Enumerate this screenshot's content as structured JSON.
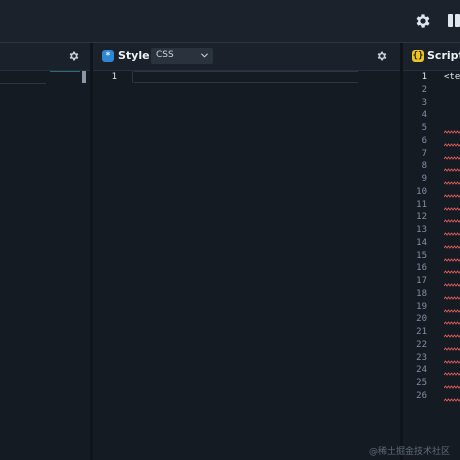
{
  "toolbar": {
    "settings_icon": "gear-icon",
    "layout_icon": "layout-columns-icon"
  },
  "panels": {
    "left": {
      "settings_icon": "gear-icon"
    },
    "style": {
      "badge_icon": "asterisk-icon",
      "badge_color": "#2f86d6",
      "title": "Style",
      "language_select": "CSS",
      "settings_icon": "gear-icon",
      "line_numbers": [
        "1"
      ]
    },
    "script": {
      "badge_icon": "braces-icon",
      "badge_color": "#e8c521",
      "title": "Script",
      "first_line": "<te",
      "line_numbers": [
        "1",
        "2",
        "3",
        "4",
        "5",
        "6",
        "7",
        "8",
        "9",
        "10",
        "11",
        "12",
        "13",
        "14",
        "15",
        "16",
        "17",
        "18",
        "19",
        "20",
        "21",
        "22",
        "23",
        "24",
        "25",
        "26"
      ]
    }
  },
  "colors": {
    "background": "#151b23",
    "error_squiggle": "#e05a5a"
  },
  "watermark": "@稀土掘金技术社区"
}
